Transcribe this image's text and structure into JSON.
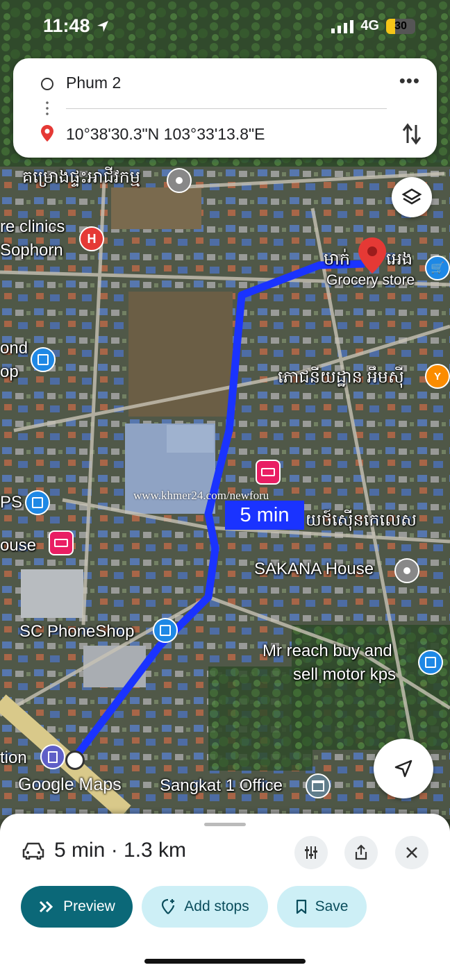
{
  "status_bar": {
    "time": "11:48",
    "network": "4G",
    "battery": "30",
    "battery_level": 0.3
  },
  "route": {
    "origin": "Phum 2",
    "destination": "10°38'30.3\"N 103°33'13.8\"E",
    "more_icon": "more-horizontal-icon",
    "swap_icon": "swap-vertical-icon"
  },
  "map": {
    "labels": {
      "top_khmer": "គម្រោងផ្ទះអាជីវកម្ម",
      "clinics": "re clinics",
      "sophorn": "Sophorn",
      "mart": "មាក់",
      "mart_suffix": "អេង",
      "grocery": "Grocery store",
      "pond": "ond",
      "op": "op",
      "restaurant": "ភោជនីយដ្ឋាន អឹមស៊ី",
      "ps": "PS",
      "ouse": "ouse",
      "guesthouse": "យថ៍ស៊ើនកេលេស",
      "sakana": "SAKANA House",
      "phoneshop": "SC PhoneShop",
      "mr_reach_1": "Mr reach buy and",
      "mr_reach_2": "sell motor kps",
      "tion": "tion",
      "sangkat": "Sangkat 1 Office"
    },
    "route_duration": "5 min",
    "watermark": "www.khmer24.com/newforu",
    "logo": "Google Maps",
    "colors": {
      "route": "#1a33ff",
      "pin": "#e53935"
    }
  },
  "sheet": {
    "summary": "5 min · 1.3 km",
    "buttons": {
      "preview": "Preview",
      "add_stops": "Add stops",
      "save": "Save"
    },
    "accent": "#0b6878"
  }
}
